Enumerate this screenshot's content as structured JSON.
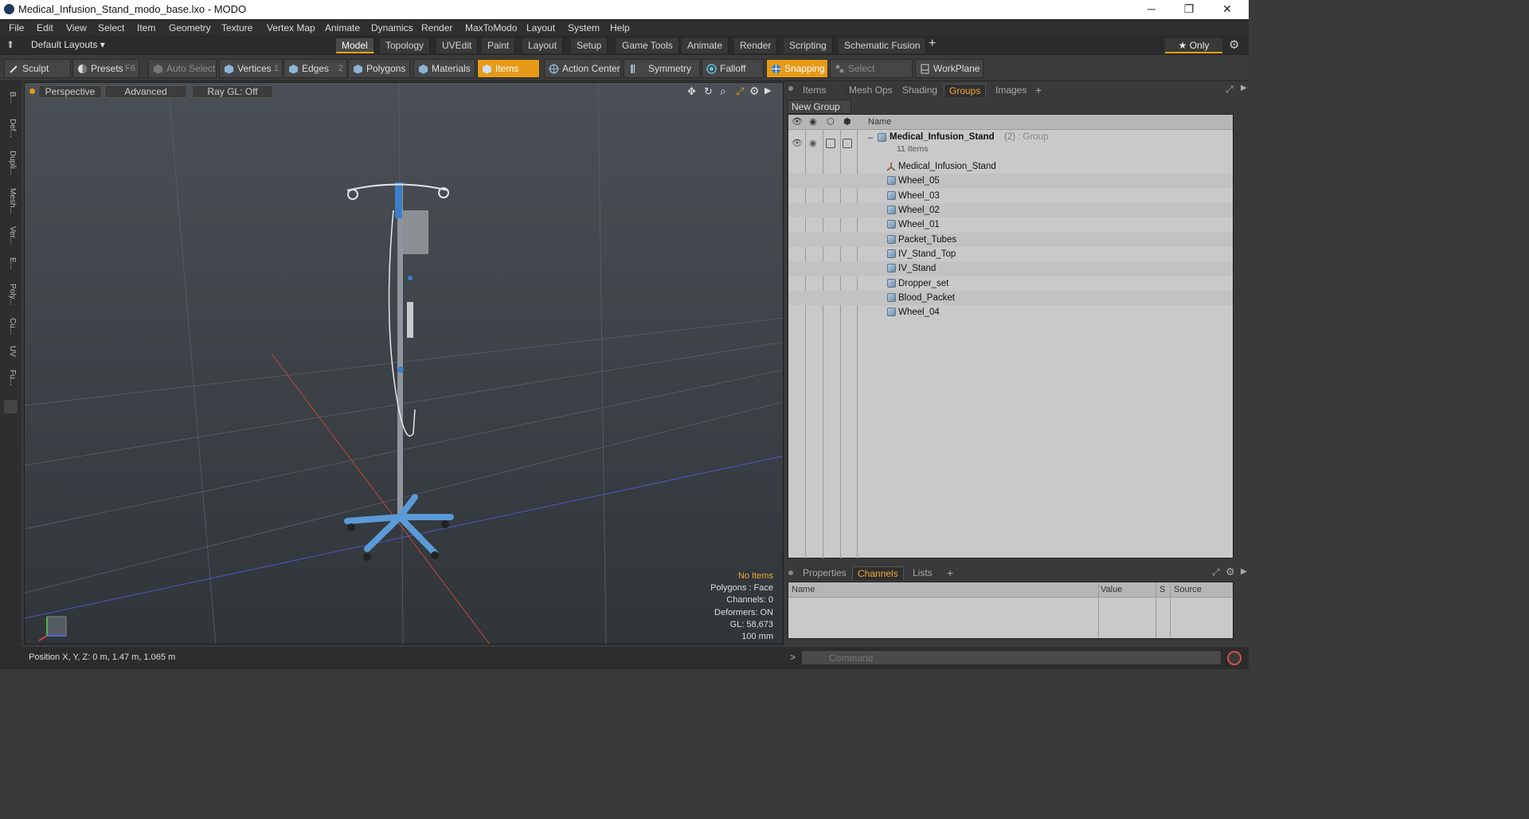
{
  "window": {
    "title": "Medical_Infusion_Stand_modo_base.lxo - MODO",
    "minimize": "─",
    "maximize": "❐",
    "close": "✕"
  },
  "menu": [
    "File",
    "Edit",
    "View",
    "Select",
    "Item",
    "Geometry",
    "Texture",
    "Vertex Map",
    "Animate",
    "Dynamics",
    "Render",
    "MaxToModo",
    "Layout",
    "System",
    "Help"
  ],
  "layouts": {
    "label": "Default Layouts ▾"
  },
  "tabs": [
    "Model",
    "Topology",
    "UVEdit",
    "Paint",
    "Layout",
    "Setup",
    "Game Tools",
    "Animate",
    "Render",
    "Scripting",
    "Schematic Fusion"
  ],
  "tab_add": "+",
  "only_label": "★ Only",
  "toolbar": {
    "sculpt": "Sculpt",
    "presets": "Presets",
    "presets_key": "F6",
    "auto_select": "Auto Select",
    "vertices": "Vertices",
    "vertices_num": "1",
    "edges": "Edges",
    "edges_num": "2",
    "polygons": "Polygons",
    "materials": "Materials",
    "items": "Items",
    "action_center": "Action Center",
    "symmetry": "Symmetry",
    "falloff": "Falloff",
    "snapping": "Snapping",
    "select_through": "Select Through",
    "workplane": "WorkPlane"
  },
  "left_tabs": [
    "B...",
    "Def...",
    "Dupli...",
    "Mesh...",
    "Ver...",
    "E...",
    "Poly...",
    "Cu...",
    "UV",
    "Fu..."
  ],
  "viewport": {
    "perspective": "Perspective",
    "advanced": "Advanced",
    "raygl": "Ray GL: Off",
    "info": {
      "items": "No Items",
      "polygons": "Polygons : Face",
      "channels": "Channels: 0",
      "deformers": "Deformers: ON",
      "gl": "GL: 58,673",
      "scale": "100 mm"
    }
  },
  "panel_tabs": [
    "Items",
    "Mesh Ops",
    "Shading",
    "Groups",
    "Images"
  ],
  "panel_tab_add": "+",
  "new_group": "New Group",
  "groups": {
    "col_name": "Name",
    "root": {
      "name": "Medical_Infusion_Stand",
      "count": "(2)",
      "type": ": Group",
      "sub": "11 Items"
    },
    "items": [
      "Medical_Infusion_Stand",
      "Wheel_05",
      "Wheel_03",
      "Wheel_02",
      "Wheel_01",
      "Packet_Tubes",
      "IV_Stand_Top",
      "IV_Stand",
      "Dropper_set",
      "Blood_Packet",
      "Wheel_04"
    ]
  },
  "bottom_tabs": [
    "Properties",
    "Channels",
    "Lists"
  ],
  "bottom_tab_add": "+",
  "channels_cols": {
    "name": "Name",
    "value": "Value",
    "s": "S",
    "source": "Source"
  },
  "status": {
    "position": "Position X, Y, Z:   0 m, 1.47 m, 1.065 m"
  },
  "command": {
    "prompt": ">",
    "placeholder": "Command"
  },
  "colors": {
    "accent": "#e69a18",
    "tab_active": "#f0a830"
  }
}
